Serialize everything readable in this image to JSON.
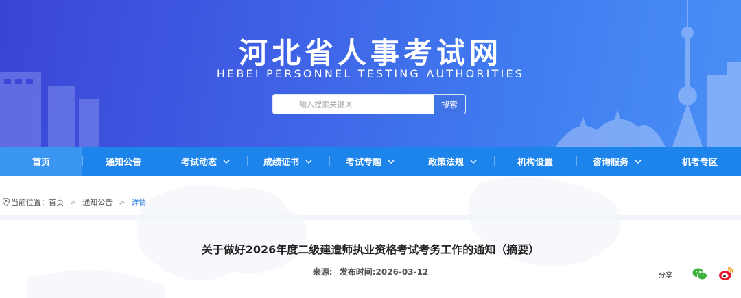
{
  "header": {
    "title": "河北省人事考试网",
    "subtitle": "HEBEI PERSONNEL TESTING AUTHORITIES",
    "search": {
      "placeholder": "输入搜索关键词",
      "value": "",
      "button_label": "搜索"
    }
  },
  "nav": {
    "items": [
      {
        "label": "首页",
        "active": true,
        "dropdown": false
      },
      {
        "label": "通知公告",
        "active": false,
        "dropdown": false
      },
      {
        "label": "考试动态",
        "active": false,
        "dropdown": true
      },
      {
        "label": "成绩证书",
        "active": false,
        "dropdown": true
      },
      {
        "label": "考试专题",
        "active": false,
        "dropdown": true
      },
      {
        "label": "政策法规",
        "active": false,
        "dropdown": true
      },
      {
        "label": "机构设置",
        "active": false,
        "dropdown": false
      },
      {
        "label": "咨询服务",
        "active": false,
        "dropdown": true
      },
      {
        "label": "机考专区",
        "active": false,
        "dropdown": false
      }
    ]
  },
  "breadcrumb": {
    "prefix": "当前位置：",
    "items": [
      "首页",
      "通知公告"
    ],
    "current": "详情",
    "separator": ">"
  },
  "article": {
    "title": "关于做好2026年度二级建造师执业资格考试考务工作的通知（摘要）",
    "source_label": "来源:",
    "source_value": "",
    "date_label": "发布时间:",
    "date_value": "2026-03-12"
  },
  "share": {
    "label": "分享",
    "icons": [
      "wechat-icon",
      "weibo-icon"
    ]
  },
  "colors": {
    "banner_start": "#3a44d6",
    "banner_end": "#4a8ff5",
    "nav_bg": "#1c84ea",
    "nav_active": "#3b96f2",
    "link_blue": "#2f7fe0",
    "wechat_green": "#3db23a",
    "weibo_red": "#e6162d",
    "weibo_yellow": "#f5a623"
  }
}
